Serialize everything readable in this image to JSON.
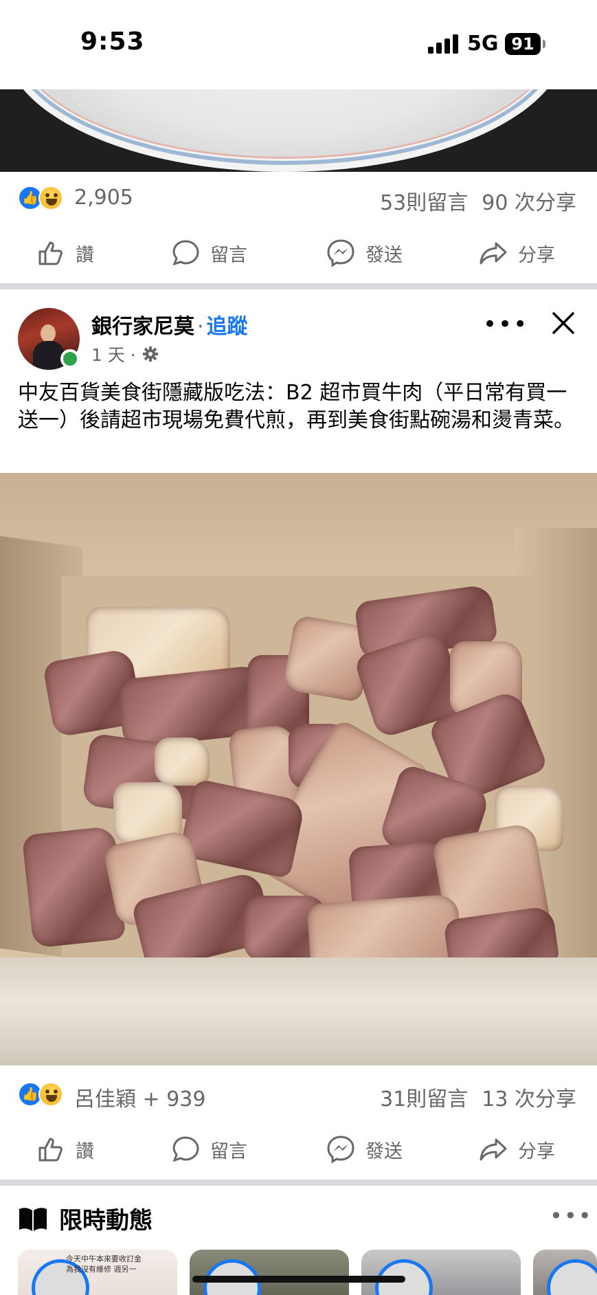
{
  "status_bar": {
    "time": "9:53",
    "network": "5G",
    "battery": "91"
  },
  "post1": {
    "reaction_count": "2,905",
    "comments": "53則留言",
    "shares": "90 次分享"
  },
  "actions": {
    "like": "讚",
    "comment": "留言",
    "send": "發送",
    "share": "分享"
  },
  "post2": {
    "author": "銀行家尼莫",
    "separator": "·",
    "follow": "追蹤",
    "time": "1 天 ·",
    "text": "中友百貨美食街隱藏版吃法：B2 超市買牛肉（平日常有買一送一）後請超市現場免費代煎，再到美食街點碗湯和燙青菜。",
    "reactors": "呂佳穎 + 939",
    "comments": "31則留言",
    "shares": "13 次分享"
  },
  "stories": {
    "title": "限時動態",
    "card1_caption": [
      "今天中午本來要收訂金",
      "為我沒有維修 週另一"
    ]
  },
  "icons": {
    "like": "thumbs-up-icon",
    "comment": "speech-bubble-icon",
    "send": "messenger-icon",
    "share": "share-arrow-icon",
    "privacy": "gear-icon",
    "stories": "book-icon"
  },
  "colors": {
    "accent": "#1877f2",
    "secondary_text": "#65676b",
    "online": "#31a24c"
  }
}
